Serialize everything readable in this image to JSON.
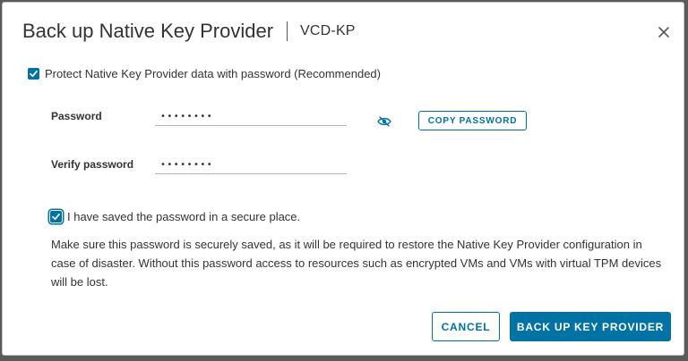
{
  "dialog": {
    "title": "Back up Native Key Provider",
    "subtitle": "VCD-KP"
  },
  "protect": {
    "label": "Protect Native Key Provider data with password (Recommended)",
    "checked": true
  },
  "password": {
    "label": "Password",
    "value": "••••••••",
    "copy_label": "COPY PASSWORD"
  },
  "verify": {
    "label": "Verify password",
    "value": "••••••••"
  },
  "saved": {
    "label": "I have saved the password in a secure place.",
    "checked": true
  },
  "warning": {
    "text": "Make sure this password is securely saved, as it will be required to restore the Native Key Provider configuration in case of disaster. Without this password access to resources such as encrypted VMs and VMs with virtual TPM devices will be lost."
  },
  "footer": {
    "cancel_label": "CANCEL",
    "primary_label": "BACK UP KEY PROVIDER"
  },
  "colors": {
    "accent": "#0072a3",
    "text": "#333333",
    "field_underline": "#b3b3b3"
  },
  "icons": {
    "close": "close-icon",
    "checkbox": "checkmark-icon",
    "show_password": "eye-hide-icon"
  }
}
